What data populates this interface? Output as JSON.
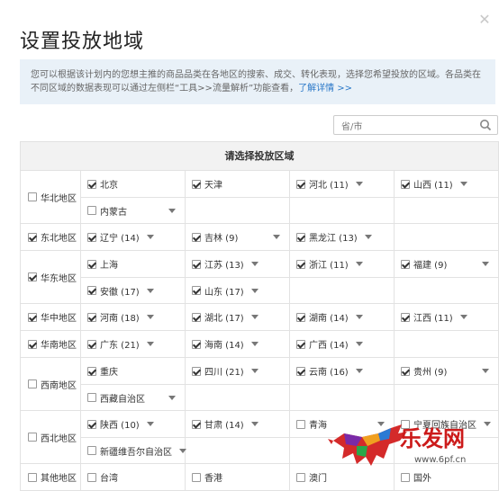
{
  "dialog": {
    "title": "设置投放地域",
    "close_glyph": "✕",
    "notice_text": "您可以根据该计划内的您想主推的商品品类在各地区的搜索、成交、转化表现，选择您希望投放的区域。各品类在不同区域的数据表现可以通过左侧栏“工具>>流量解析”功能查看，",
    "notice_link": "了解详情 >>"
  },
  "search": {
    "placeholder": "省/市"
  },
  "table": {
    "header": "请选择投放区域",
    "regions": [
      {
        "name": "华北地区",
        "checked": false,
        "rows": [
          [
            {
              "label": "北京",
              "checked": true,
              "dropdown": false
            },
            {
              "label": "天津",
              "checked": true,
              "dropdown": false
            },
            {
              "label": "河北 (11)",
              "checked": true,
              "dropdown": true
            },
            {
              "label": "山西 (11)",
              "checked": true,
              "dropdown": true
            }
          ],
          [
            {
              "label": "内蒙古",
              "checked": false,
              "dropdown": true
            }
          ]
        ]
      },
      {
        "name": "东北地区",
        "checked": true,
        "rows": [
          [
            {
              "label": "辽宁 (14)",
              "checked": true,
              "dropdown": true
            },
            {
              "label": "吉林 (9)",
              "checked": true,
              "dropdown": true
            },
            {
              "label": "黑龙江 (13)",
              "checked": true,
              "dropdown": true
            }
          ]
        ]
      },
      {
        "name": "华东地区",
        "checked": true,
        "rows": [
          [
            {
              "label": "上海",
              "checked": true,
              "dropdown": false
            },
            {
              "label": "江苏 (13)",
              "checked": true,
              "dropdown": true
            },
            {
              "label": "浙江 (11)",
              "checked": true,
              "dropdown": true
            },
            {
              "label": "福建 (9)",
              "checked": true,
              "dropdown": true
            }
          ],
          [
            {
              "label": "安徽 (17)",
              "checked": true,
              "dropdown": true
            },
            {
              "label": "山东 (17)",
              "checked": true,
              "dropdown": true
            }
          ]
        ]
      },
      {
        "name": "华中地区",
        "checked": true,
        "rows": [
          [
            {
              "label": "河南 (18)",
              "checked": true,
              "dropdown": true
            },
            {
              "label": "湖北 (17)",
              "checked": true,
              "dropdown": true
            },
            {
              "label": "湖南 (14)",
              "checked": true,
              "dropdown": true
            },
            {
              "label": "江西 (11)",
              "checked": true,
              "dropdown": true
            }
          ]
        ]
      },
      {
        "name": "华南地区",
        "checked": true,
        "rows": [
          [
            {
              "label": "广东 (21)",
              "checked": true,
              "dropdown": true
            },
            {
              "label": "海南 (14)",
              "checked": true,
              "dropdown": true
            },
            {
              "label": "广西 (14)",
              "checked": true,
              "dropdown": true
            }
          ]
        ]
      },
      {
        "name": "西南地区",
        "checked": false,
        "rows": [
          [
            {
              "label": "重庆",
              "checked": true,
              "dropdown": false
            },
            {
              "label": "四川 (21)",
              "checked": true,
              "dropdown": true
            },
            {
              "label": "云南 (16)",
              "checked": true,
              "dropdown": true
            },
            {
              "label": "贵州 (9)",
              "checked": true,
              "dropdown": true
            }
          ],
          [
            {
              "label": "西藏自治区",
              "checked": false,
              "dropdown": true
            }
          ]
        ]
      },
      {
        "name": "西北地区",
        "checked": false,
        "rows": [
          [
            {
              "label": "陕西 (10)",
              "checked": true,
              "dropdown": true
            },
            {
              "label": "甘肃 (14)",
              "checked": true,
              "dropdown": true
            },
            {
              "label": "青海",
              "checked": false,
              "dropdown": true
            },
            {
              "label": "宁夏回族自治区",
              "checked": false,
              "dropdown": true
            }
          ],
          [
            {
              "label": "新疆维吾尔自治区",
              "checked": false,
              "dropdown": true
            }
          ]
        ]
      },
      {
        "name": "其他地区",
        "checked": false,
        "rows": [
          [
            {
              "label": "台湾",
              "checked": false,
              "dropdown": false
            },
            {
              "label": "香港",
              "checked": false,
              "dropdown": false
            },
            {
              "label": "澳门",
              "checked": false,
              "dropdown": false
            },
            {
              "label": "国外",
              "checked": false,
              "dropdown": false
            }
          ]
        ]
      }
    ]
  },
  "watermark": {
    "brand": "乐发网",
    "url": "www.6pf.cn"
  },
  "colors": {
    "link": "#2a78c8",
    "notice_bg": "#e9f1f8",
    "header_bg": "#f2f2f2",
    "border": "#e2e2e2",
    "watermark_red": "#cc1a1a"
  }
}
